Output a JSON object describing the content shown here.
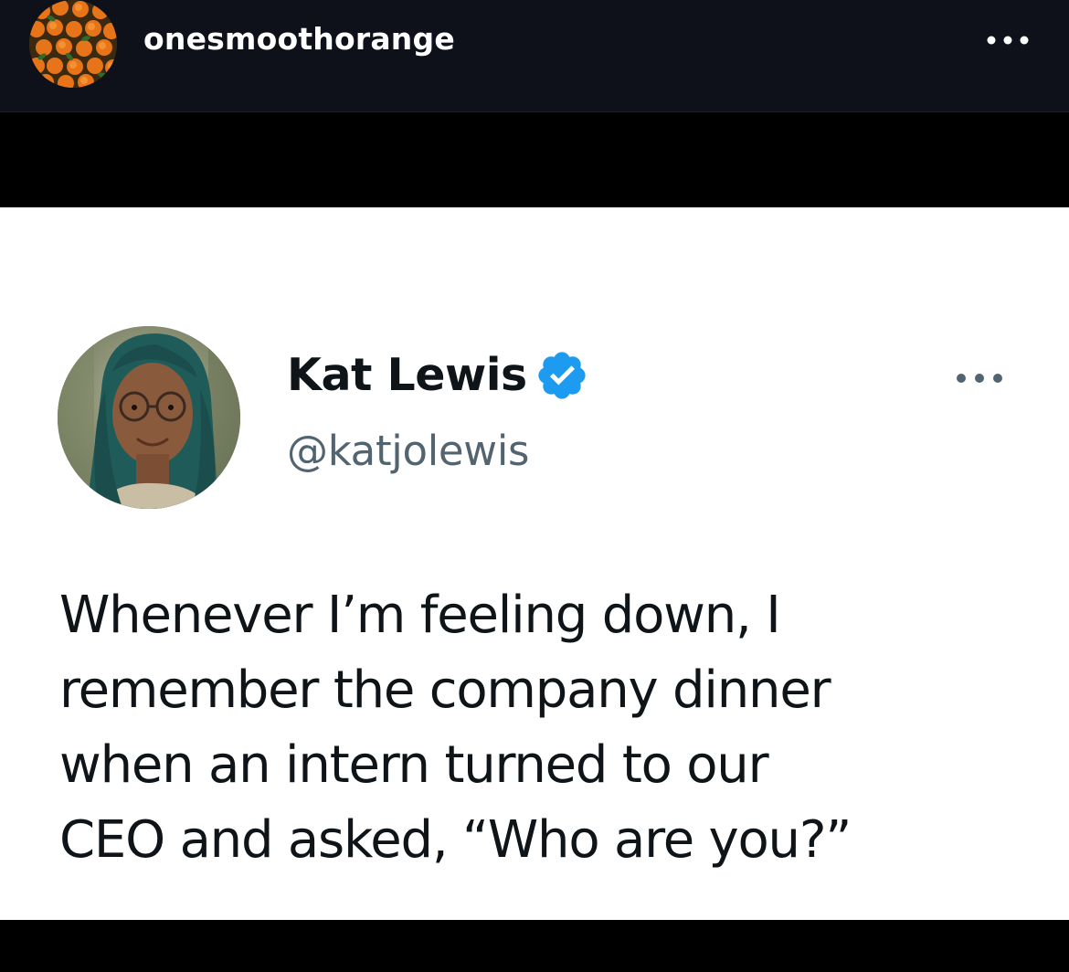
{
  "post": {
    "username": "onesmoothorange",
    "avatar_icon": "oranges-avatar",
    "more_icon": "more-horizontal-icon"
  },
  "tweet": {
    "display_name": "Kat Lewis",
    "verified_icon": "verified-badge-icon",
    "handle": "@katjolewis",
    "more_icon": "more-horizontal-icon",
    "text": "Whenever I’m feeling down, I\nremember the company dinner\nwhen an intern turned to our\nCEO and asked, “Who are you?”"
  },
  "colors": {
    "header_bg": "#0e111a",
    "page_bg": "#000000",
    "tweet_bg": "#ffffff",
    "tweet_text": "#0f1419",
    "handle_text": "#536471",
    "verified_blue": "#1d9bf0",
    "username_text": "#ffffff"
  }
}
